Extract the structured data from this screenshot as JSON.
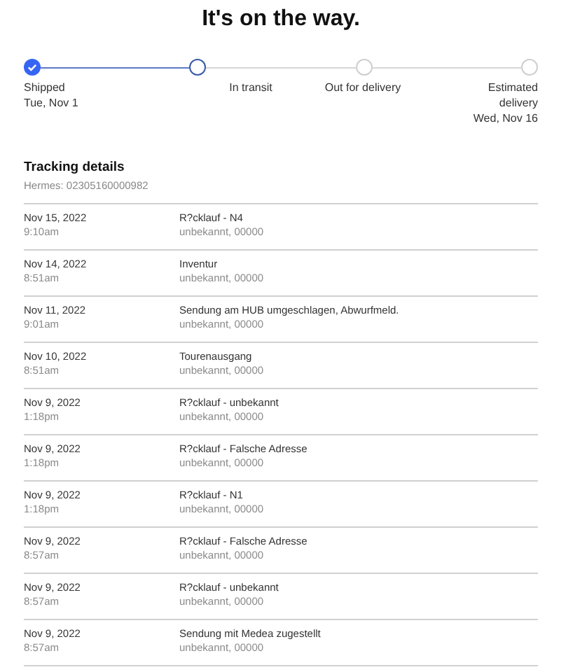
{
  "title": "It's on the way.",
  "steps": [
    {
      "kind": "done",
      "label": "Shipped",
      "date": "Tue, Nov 1"
    },
    {
      "kind": "current",
      "label": "In transit"
    },
    {
      "kind": "pending",
      "label": "Out for delivery"
    },
    {
      "kind": "pending",
      "label": "Estimated delivery",
      "date": "Wed, Nov 16"
    }
  ],
  "tracking": {
    "heading": "Tracking details",
    "number": "Hermes: 02305160000982",
    "rows": [
      {
        "date": "Nov 15, 2022",
        "time": "9:10am",
        "event": "R?cklauf - N4",
        "location": "unbekannt, 00000"
      },
      {
        "date": "Nov 14, 2022",
        "time": "8:51am",
        "event": "Inventur",
        "location": "unbekannt, 00000"
      },
      {
        "date": "Nov 11, 2022",
        "time": "9:01am",
        "event": "Sendung am HUB umgeschlagen, Abwurfmeld.",
        "location": "unbekannt, 00000"
      },
      {
        "date": "Nov 10, 2022",
        "time": "8:51am",
        "event": "Tourenausgang",
        "location": "unbekannt, 00000"
      },
      {
        "date": "Nov 9, 2022",
        "time": "1:18pm",
        "event": "R?cklauf - unbekannt",
        "location": "unbekannt, 00000"
      },
      {
        "date": "Nov 9, 2022",
        "time": "1:18pm",
        "event": "R?cklauf - Falsche Adresse",
        "location": "unbekannt, 00000"
      },
      {
        "date": "Nov 9, 2022",
        "time": "1:18pm",
        "event": "R?cklauf - N1",
        "location": "unbekannt, 00000"
      },
      {
        "date": "Nov 9, 2022",
        "time": "8:57am",
        "event": "R?cklauf - Falsche Adresse",
        "location": "unbekannt, 00000"
      },
      {
        "date": "Nov 9, 2022",
        "time": "8:57am",
        "event": "R?cklauf - unbekannt",
        "location": "unbekannt, 00000"
      },
      {
        "date": "Nov 9, 2022",
        "time": "8:57am",
        "event": "Sendung mit Medea zugestellt",
        "location": "unbekannt, 00000"
      }
    ]
  }
}
